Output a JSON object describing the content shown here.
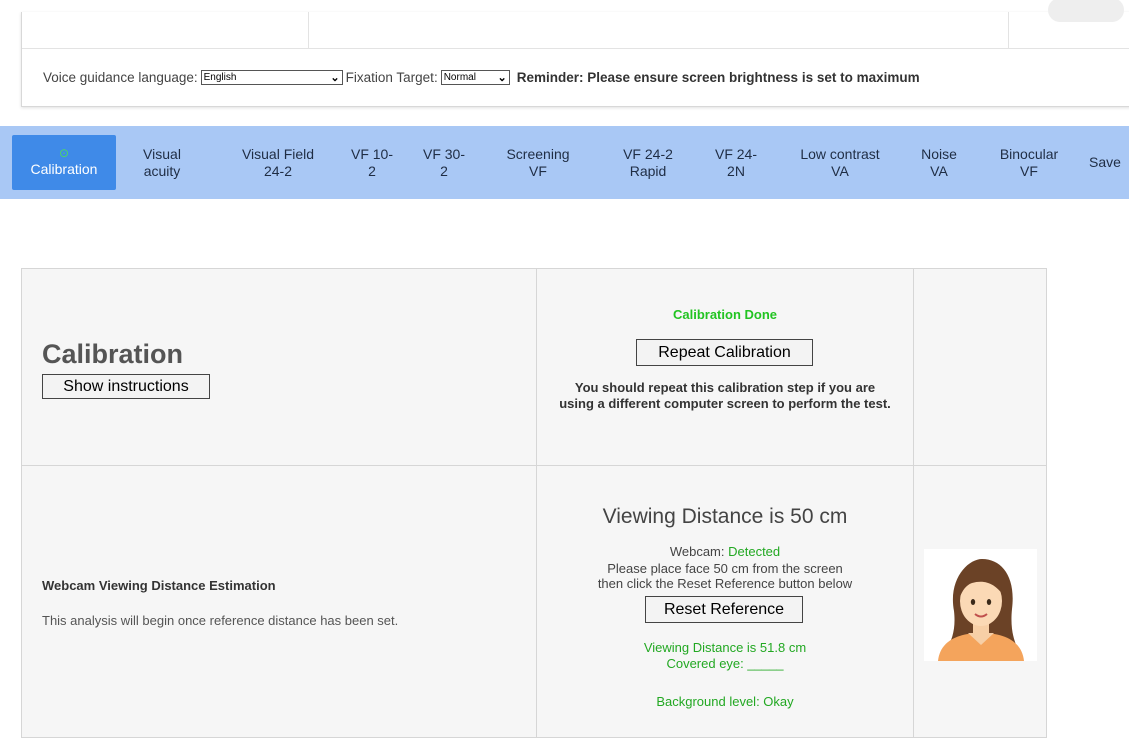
{
  "settings": {
    "voice_label": "Voice guidance language:",
    "voice_value": "English",
    "fixation_label": "Fixation Target:",
    "fixation_value": "Normal",
    "reminder": "Reminder: Please ensure screen brightness is set to maximum"
  },
  "nav": {
    "items": [
      {
        "label": "Calibration",
        "active": true,
        "check_icon": "check-circle-icon"
      },
      {
        "label": "Visual\nacuity"
      },
      {
        "label": "Visual Field\n24-2"
      },
      {
        "label": "VF 10-\n2"
      },
      {
        "label": "VF 30-\n2"
      },
      {
        "label": "Screening\nVF"
      },
      {
        "label": "VF 24-2\nRapid"
      },
      {
        "label": "VF 24-\n2N"
      },
      {
        "label": "Low contrast\nVA"
      },
      {
        "label": "Noise\nVA"
      },
      {
        "label": "Binocular\nVF"
      },
      {
        "label": "Save"
      }
    ]
  },
  "calibration": {
    "title": "Calibration",
    "show_instructions": "Show instructions",
    "done_text": "Calibration Done",
    "repeat_button": "Repeat Calibration",
    "note": "You should repeat this calibration step if you are using a different computer screen to perform the test."
  },
  "webcam": {
    "title": "Webcam Viewing Distance Estimation",
    "subtitle": "This analysis will begin once reference distance has been set.",
    "heading": "Viewing Distance is 50 cm",
    "status_label": "Webcam: ",
    "status_value": "Detected",
    "place_note": "Please place face 50 cm from the screen then click the Reset Reference button below",
    "reset_button": "Reset Reference",
    "measured": "Viewing Distance is 51.8 cm",
    "covered_eye": "Covered eye: _____",
    "background": "Background level: Okay",
    "avatar_icon": "woman-avatar-icon"
  },
  "colors": {
    "nav_bg": "#a9c8f5",
    "nav_active": "#3f8ae8",
    "success": "#22c422"
  }
}
